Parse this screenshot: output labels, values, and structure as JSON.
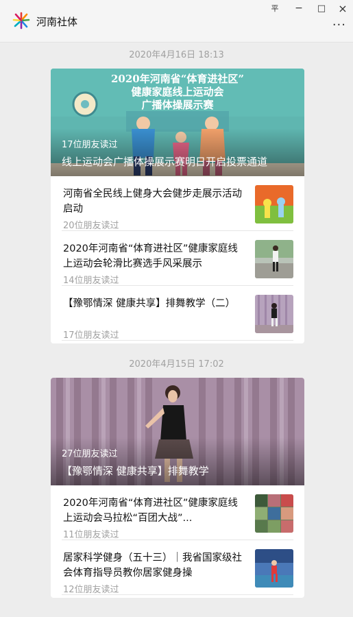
{
  "app": {
    "title": "河南社体"
  },
  "window_controls": {
    "pin": "平",
    "minimize": "−",
    "maximize": "□",
    "close": "×",
    "more": "···"
  },
  "groups": [
    {
      "time": "2020年4月16日 18:13",
      "hero": {
        "reads": "17位朋友读过",
        "title": "线上运动会广播体操展示赛明日开启投票通道",
        "banner_lines": [
          "2020年河南省“体育进社区”",
          "健康家庭线上运动会",
          "广播体操展示赛"
        ]
      },
      "items": [
        {
          "title": "河南省全民线上健身大会健步走展示活动启动",
          "reads": "20位朋友读过"
        },
        {
          "title": "2020年河南省“体育进社区”健康家庭线上运动会轮滑比赛选手风采展示",
          "reads": "14位朋友读过"
        },
        {
          "title": "【豫鄂情深 健康共享】排舞教学（二）",
          "reads": "17位朋友读过"
        }
      ]
    },
    {
      "time": "2020年4月15日 17:02",
      "hero": {
        "reads": "27位朋友读过",
        "title": "【豫鄂情深 健康共享】排舞教学"
      },
      "items": [
        {
          "title": "2020年河南省“体育进社区”健康家庭线上运动会马拉松“百团大战”...",
          "reads": "11位朋友读过"
        },
        {
          "title": "居家科学健身（五十三）｜我省国家级社会体育指导员教你居家健身操",
          "reads": "12位朋友读过"
        }
      ]
    }
  ],
  "colors": {
    "background": "#ededed",
    "card": "#ffffff",
    "muted_text": "#a0a0a0"
  }
}
